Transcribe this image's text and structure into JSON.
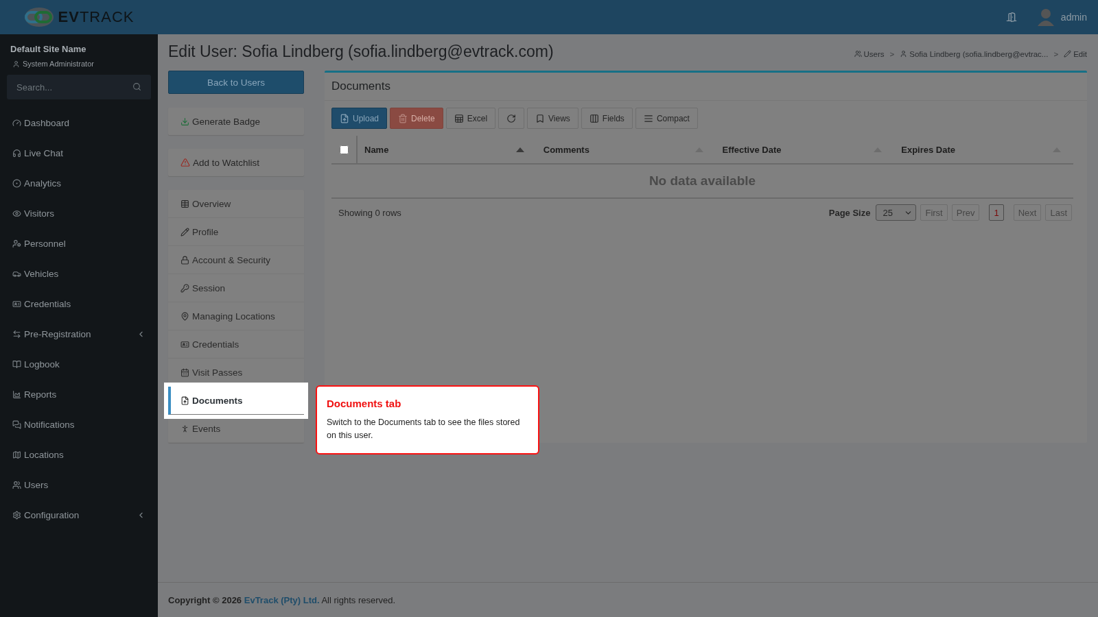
{
  "header": {
    "logo": "**EV**TRACK",
    "user": "admin"
  },
  "sidebar": {
    "site_name": "Default Site Name",
    "role": "System Administrator",
    "search": {
      "placeholder": "Search..."
    },
    "items": [
      {
        "label": "Dashboard",
        "expandable": false
      },
      {
        "label": "Live Chat",
        "expandable": false
      },
      {
        "label": "Analytics",
        "expandable": false
      },
      {
        "label": "Visitors",
        "expandable": false
      },
      {
        "label": "Personnel",
        "expandable": false
      },
      {
        "label": "Vehicles",
        "expandable": false
      },
      {
        "label": "Credentials",
        "expandable": false
      },
      {
        "label": "Pre-Registration",
        "expandable": true
      },
      {
        "label": "Logbook",
        "expandable": false
      },
      {
        "label": "Reports",
        "expandable": false
      },
      {
        "label": "Notifications",
        "expandable": false
      },
      {
        "label": "Locations",
        "expandable": false
      },
      {
        "label": "Users",
        "expandable": false
      },
      {
        "label": "Configuration",
        "expandable": true
      }
    ]
  },
  "page": {
    "title": "Edit User: Sofia Lindberg (sofia.lindberg@evtrack.com)",
    "breadcrumbs": [
      {
        "label": "Users",
        "separator": ">"
      },
      {
        "label": "Sofia Lindberg (sofia.lindberg@evtrac...",
        "separator": ">"
      },
      {
        "label": "Edit"
      }
    ],
    "back_button": "Back to Users",
    "actions": [
      {
        "label": "Generate Badge",
        "kind": "download"
      },
      {
        "label": "Add to Watchlist",
        "kind": "warning"
      }
    ],
    "tabs": [
      {
        "label": "Overview",
        "selected": false
      },
      {
        "label": "Profile",
        "selected": false
      },
      {
        "label": "Account & Security",
        "selected": false
      },
      {
        "label": "Session",
        "selected": false
      },
      {
        "label": "Managing Locations",
        "selected": false
      },
      {
        "label": "Credentials",
        "selected": false
      },
      {
        "label": "Visit Passes",
        "selected": false
      },
      {
        "label": "Documents",
        "selected": true
      },
      {
        "label": "Events",
        "selected": false
      }
    ]
  },
  "documents": {
    "title": "Documents",
    "toolbar": [
      {
        "label": "Upload",
        "kind": "primary",
        "disabled": false
      },
      {
        "label": "Delete",
        "kind": "danger",
        "disabled": true
      },
      {
        "label": "Excel",
        "kind": "excel",
        "disabled": false
      },
      {
        "kind": "refresh",
        "disabled": false
      },
      {
        "label": "Views",
        "kind": "views",
        "disabled": false
      },
      {
        "label": "Fields",
        "kind": "fields",
        "disabled": false
      },
      {
        "label": "Compact",
        "kind": "compact",
        "disabled": false
      }
    ],
    "select_all": {
      "checked": false
    },
    "columns": [
      "Name",
      "Comments",
      "Effective Date",
      "Expires Date"
    ],
    "empty_text": "No data available",
    "row_count": "Showing 0 rows",
    "page_size": {
      "label": "Page Size",
      "value": "25"
    },
    "pager": [
      {
        "label": "First",
        "disabled": true,
        "selected": false
      },
      {
        "label": "Prev",
        "disabled": true,
        "selected": false
      },
      {
        "label": "1",
        "disabled": false,
        "selected": true
      },
      {
        "label": "Next",
        "disabled": true,
        "selected": false
      },
      {
        "label": "Last",
        "disabled": true,
        "selected": false
      }
    ]
  },
  "tooltip": {
    "title": "Documents tab",
    "body": "Switch to the Documents tab to see the files stored on this user."
  },
  "footer": {
    "prefix": "**Copyright © 2026**",
    "link": "EvTrack (Pty) Ltd.",
    "suffix": "All rights reserved."
  }
}
